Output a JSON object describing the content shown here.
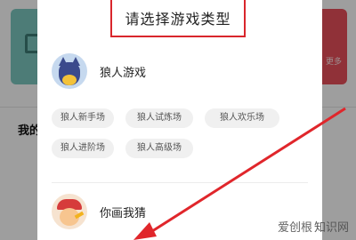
{
  "modal": {
    "title": "请选择游戏类型"
  },
  "background": {
    "heading": "我的",
    "right_card_text": "更多"
  },
  "sections": [
    {
      "title": "狼人游戏",
      "avatar_icon": "wolf-avatar-icon",
      "chips": [
        "狼人新手场",
        "狼人试炼场",
        "狼人欢乐场",
        "狼人进阶场",
        "狼人高级场"
      ]
    },
    {
      "title": "你画我猜",
      "avatar_icon": "draw-guess-avatar-icon",
      "chips": []
    }
  ],
  "annotations": {
    "title_highlight_color": "#d9262c",
    "arrow_color": "#e0262b"
  },
  "watermark": {
    "name": "爱创根",
    "domain": "知识网"
  }
}
